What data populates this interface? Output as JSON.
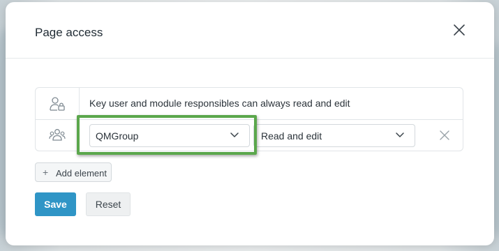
{
  "dialog": {
    "title": "Page access",
    "close_icon": "close-icon"
  },
  "access_rows": {
    "fixed_rule": {
      "icon": "user-lock-icon",
      "text": "Key user and module responsibles can always read and edit"
    },
    "group_rule": {
      "icon": "user-group-icon",
      "group_value": "QMGroup",
      "permission_value": "Read and edit",
      "remove_icon": "close-icon"
    }
  },
  "actions": {
    "add_element_label": "Add element",
    "save_label": "Save",
    "reset_label": "Reset"
  },
  "colors": {
    "primary": "#2f95c6",
    "highlight": "#5ba74c"
  }
}
